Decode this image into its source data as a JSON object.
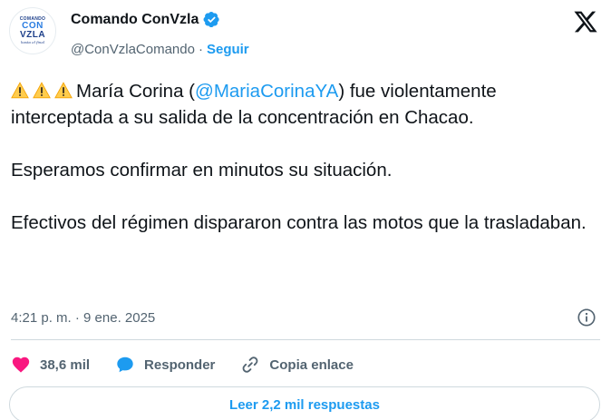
{
  "author": {
    "display_name": "Comando ConVzla",
    "handle": "@ConVzlaComando",
    "separator": "·",
    "follow_label": "Seguir",
    "avatar": {
      "line1": "COMANDO",
      "line2": "CON",
      "line3": "VZLA",
      "tagline": "hasta el final"
    }
  },
  "tweet": {
    "text_before_mention": "María Corina (",
    "mention": "@MariaCorinaYA",
    "text_after_mention": ") fue violentamente interceptada a su salida de la concentración en Chacao.",
    "paragraph2": "Esperamos confirmar en minutos su situación.",
    "paragraph3": "Efectivos del régimen dispararon contra las motos que la trasladaban.",
    "timestamp": "4:21 p. m. · 9 ene. 2025"
  },
  "actions": {
    "likes": "38,6 mil",
    "reply_label": "Responder",
    "copy_link_label": "Copia enlace"
  },
  "replies_button": "Leer 2,2 mil respuestas",
  "icons": {
    "verified": "verified-badge-icon",
    "logo": "x-logo-icon",
    "warning": "warning-icon",
    "info": "info-icon",
    "like": "heart-icon",
    "reply": "reply-bubble-icon",
    "copy": "link-icon"
  },
  "colors": {
    "accent": "#1d9bf0",
    "like": "#f91880",
    "text": "#0f1419",
    "muted": "#536471"
  }
}
